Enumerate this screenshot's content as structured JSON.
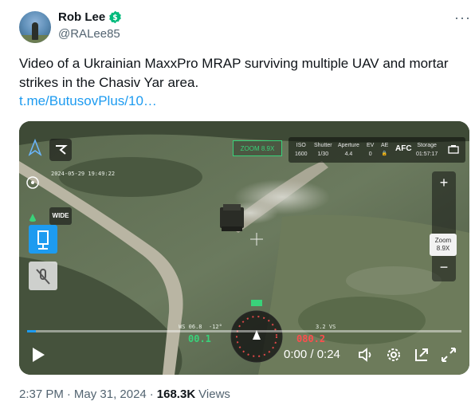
{
  "author": {
    "name": "Rob Lee",
    "handle": "@RALee85",
    "verified_color": "#00ba7c"
  },
  "more_label": "···",
  "tweet": {
    "text": "Video of a Ukrainian MaxxPro MRAP surviving multiple UAV and mortar strikes in the Chasiv Yar area.",
    "link": "t.me/ButusovPlus/10…",
    "link_color": "#1d9bf0"
  },
  "video": {
    "hud": {
      "timestamp": "2024-05-29 19:49:22",
      "zoom_indicator": "ZOOM 8.9X",
      "camera": [
        {
          "label": "ISO",
          "value": "1600"
        },
        {
          "label": "Shutter",
          "value": "1/30"
        },
        {
          "label": "Aperture",
          "value": "4.4"
        },
        {
          "label": "EV",
          "value": "0"
        },
        {
          "label": "AE",
          "value": "🔒"
        }
      ],
      "afc": "AFC",
      "storage_label": "Storage",
      "storage_value": "01:57:17",
      "wide_label": "WIDE",
      "zoom_level": "Zoom\n8.9X",
      "zoom_plus": "+",
      "zoom_minus": "−",
      "ws_label": "WS 06.8",
      "angle_label": "-12°",
      "speed_left": "00.1",
      "speed_right": "080.2",
      "vs_label": "3.2 VS"
    },
    "time": "0:00 / 0:24",
    "progress_fraction": 0.02
  },
  "footer": {
    "time": "2:37 PM",
    "sep": "·",
    "date": "May 31, 2024",
    "sep2": "·",
    "views_count": "168.3K",
    "views_label": "Views"
  }
}
